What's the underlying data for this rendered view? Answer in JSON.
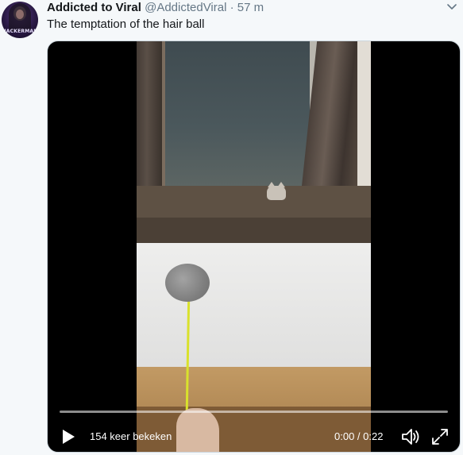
{
  "tweet": {
    "author_name": "Addicted to Viral",
    "author_handle": "@AddictedViral",
    "separator": "·",
    "timestamp": "57 m",
    "text": "The temptation of the hair ball",
    "avatar_text": "HACKERMAN"
  },
  "video": {
    "views_label": "154 keer bekeken",
    "time_label": "0:00 / 0:22",
    "progress": 0
  },
  "icons": {
    "caret": "chevron-down-icon",
    "play": "play-icon",
    "volume": "volume-icon",
    "fullscreen": "fullscreen-icon"
  },
  "colors": {
    "background": "#f5f8fa",
    "name": "#14171a",
    "secondary": "#657786",
    "border": "#ccd6dd"
  }
}
